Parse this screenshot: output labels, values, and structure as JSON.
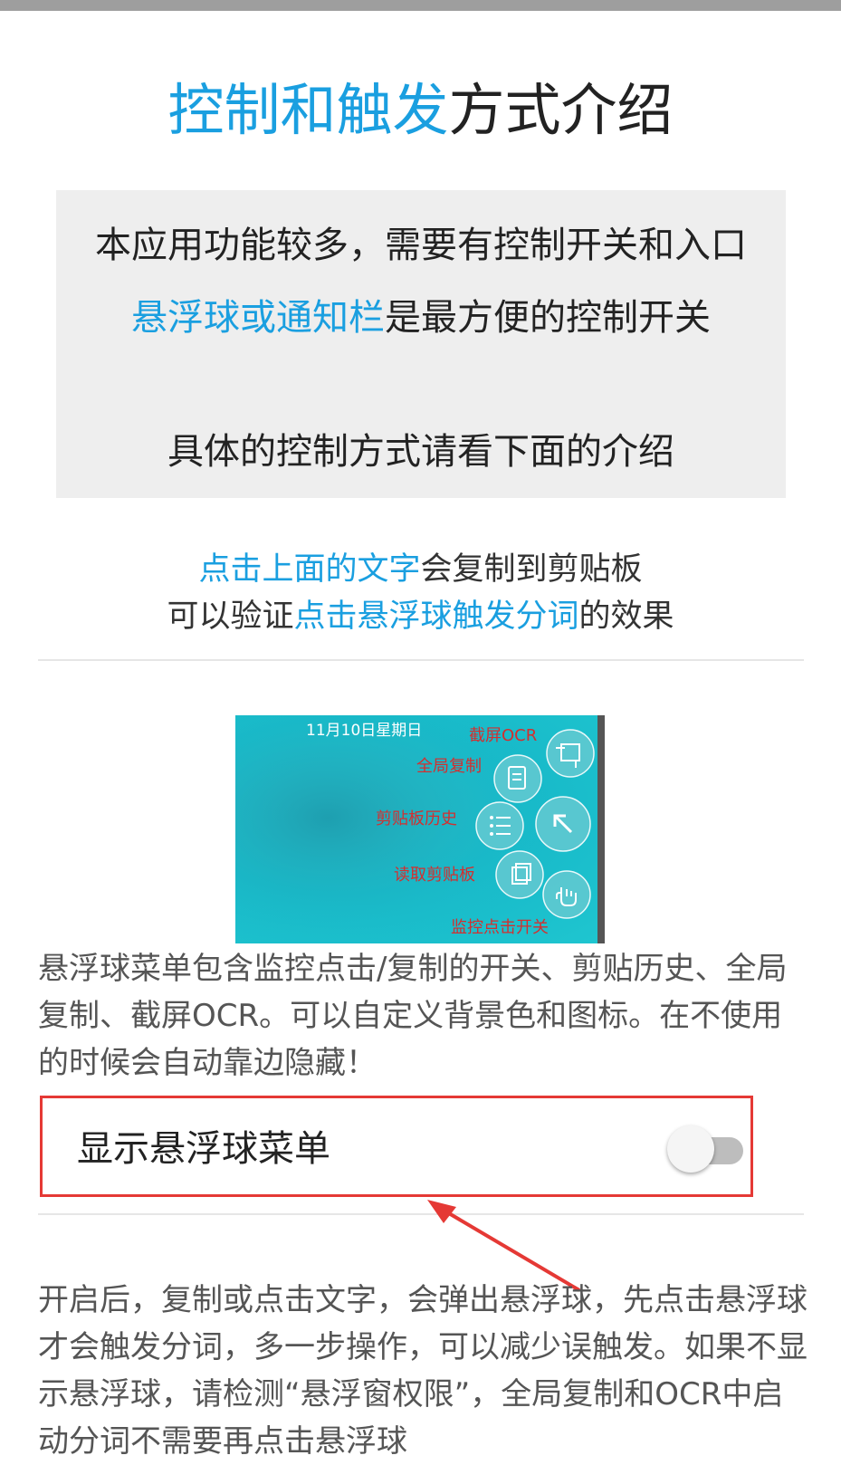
{
  "title": {
    "highlight": "控制和触发",
    "rest": "方式介绍"
  },
  "intro": {
    "line1": "本应用功能较多，需要有控制开关和入口",
    "line2_highlight": "悬浮球或通知栏",
    "line2_rest": "是最方便的控制开关",
    "line3": "具体的控制方式请看下面的介绍"
  },
  "hint": {
    "line1_highlight": "点击上面的文字",
    "line1_rest": "会复制到剪贴板",
    "line2_prefix": "可以验证",
    "line2_highlight": "点击悬浮球触发分词",
    "line2_suffix": "的效果"
  },
  "screenshot": {
    "date": "11月10日星期日",
    "labels": {
      "ocr": "截屏OCR",
      "global_copy": "全局复制",
      "clipboard_history": "剪贴板历史",
      "read_clipboard": "读取剪贴板",
      "monitor_toggle": "监控点击开关"
    }
  },
  "description": "悬浮球菜单包含监控点击/复制的开关、剪贴历史、全局复制、截屏OCR。可以自定义背景色和图标。在不使用的时候会自动靠边隐藏！",
  "toggle": {
    "label": "显示悬浮球菜单",
    "enabled": false
  },
  "bottom_text": "开启后，复制或点击文字，会弹出悬浮球，先点击悬浮球才会触发分词，多一步操作，可以减少误触发。如果不显示悬浮球，请检测“悬浮窗权限”，全局复制和OCR中启动分词不需要再点击悬浮球",
  "colors": {
    "accent": "#1a9fe0",
    "highlight_border": "#e53935",
    "annotation_red": "#d32f2f"
  }
}
